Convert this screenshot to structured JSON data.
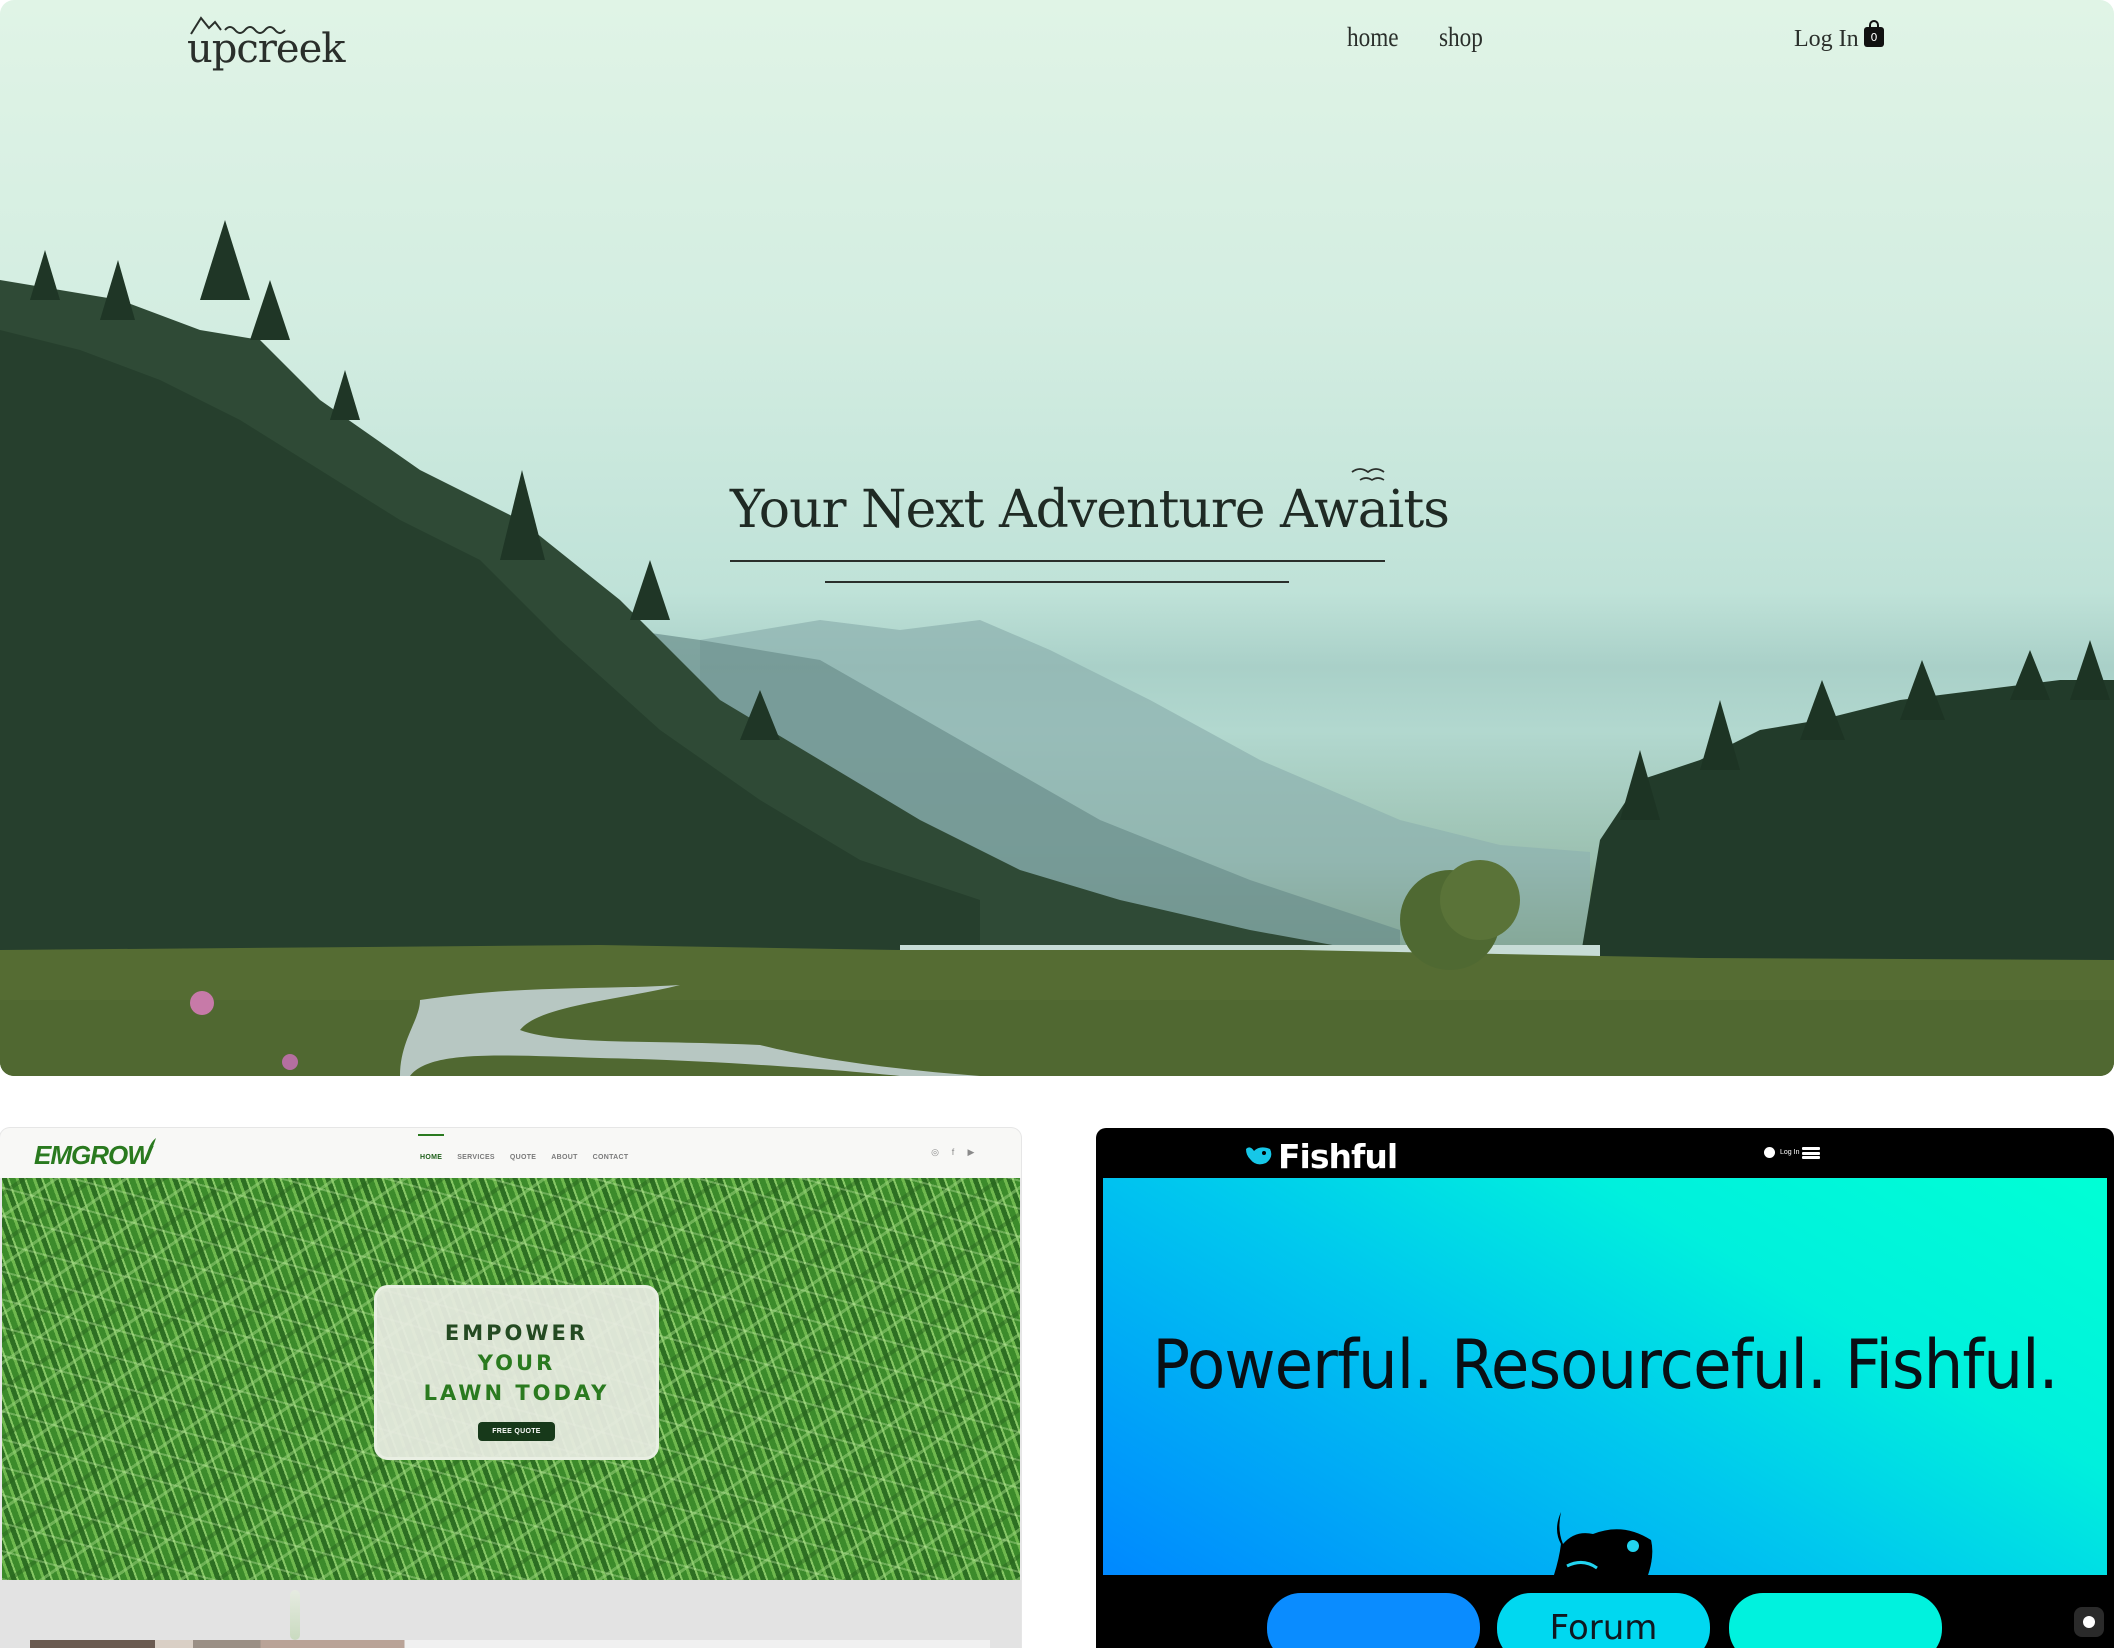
{
  "upcreek": {
    "logo_text": "upcreek",
    "nav": [
      "home",
      "shop"
    ],
    "login": "Log In",
    "cart_count": "0",
    "headline": "Your Next Adventure Awaits"
  },
  "emgrow": {
    "logo_text": "EMGROW",
    "nav": [
      "HOME",
      "SERVICES",
      "QUOTE",
      "ABOUT",
      "CONTACT"
    ],
    "social": [
      "instagram-icon",
      "facebook-icon",
      "youtube-icon"
    ],
    "card_title": [
      "EMPOWER",
      "YOUR",
      "LAWN TODAY"
    ],
    "cta": "FREE QUOTE"
  },
  "fishful": {
    "logo_text": "Fishful",
    "login": "Log In",
    "headline": "Powerful. Resourceful. Fishful.",
    "buttons": [
      "",
      "Forum",
      ""
    ]
  },
  "colors": {
    "upcreek_sky": "#d6efe0",
    "emgrow_green": "#2a7a1f",
    "emgrow_dark": "#17391a",
    "fishful_cyan": "#00f0dd",
    "fishful_blue": "#0088ff"
  }
}
